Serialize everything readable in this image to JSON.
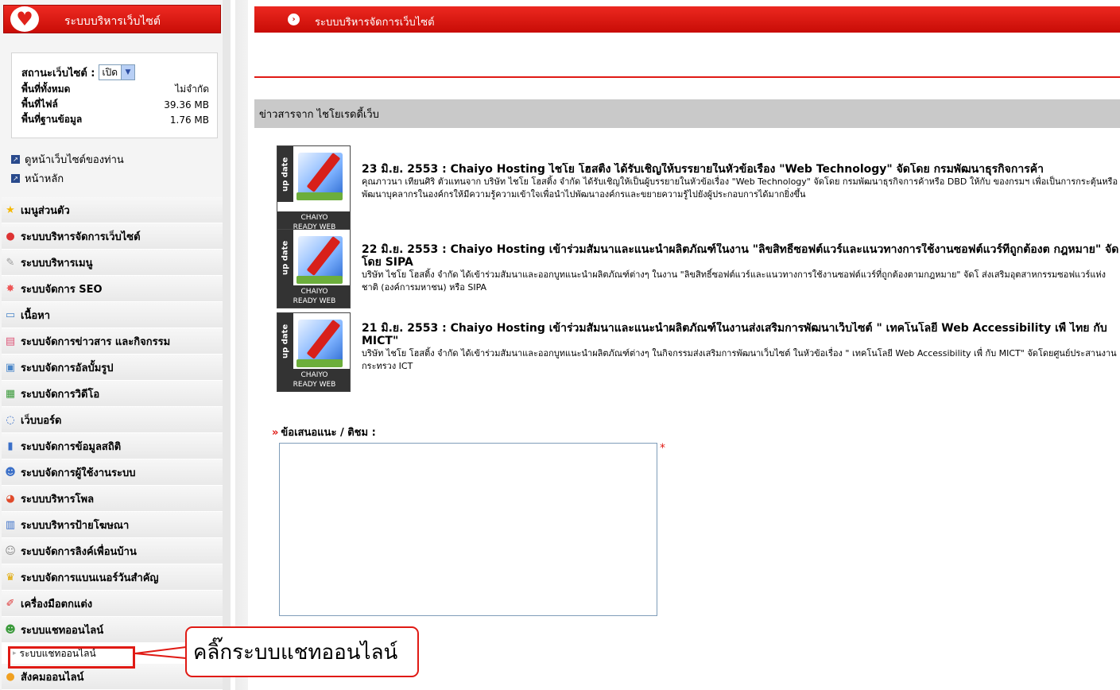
{
  "sidebar": {
    "header_title": "ระบบบริหารเว็บไซต์",
    "status": {
      "label": "สถานะเว็บไซต์ :",
      "select_value": "เปิด",
      "rows": [
        {
          "label": "พื้นที่ทั้งหมด",
          "value": "ไม่จำกัด"
        },
        {
          "label": "พื้นที่ไฟล์",
          "value": "39.36 MB"
        },
        {
          "label": "พื้นที่ฐานข้อมูล",
          "value": "1.76 MB"
        }
      ]
    },
    "links": {
      "view_site": "ดูหน้าเว็บไซต์ของท่าน",
      "home": "หน้าหลัก"
    },
    "menu": [
      {
        "label": "เมนูส่วนตัว",
        "icon": "star-icon"
      },
      {
        "label": "ระบบบริหารจัดการเว็บไซต์",
        "icon": "globe-icon"
      },
      {
        "label": "ระบบบริหารเมนู",
        "icon": "menu-icon"
      },
      {
        "label": "ระบบจัดการ SEO",
        "icon": "seo-icon"
      },
      {
        "label": "เนื้อหา",
        "icon": "document-icon"
      },
      {
        "label": "ระบบจัดการข่าวสาร และกิจกรรม",
        "icon": "news-icon"
      },
      {
        "label": "ระบบจัดการอัลบั้มรูป",
        "icon": "album-icon"
      },
      {
        "label": "ระบบจัดการวิดีโอ",
        "icon": "video-icon"
      },
      {
        "label": "เว็บบอร์ด",
        "icon": "chat-bubble-icon"
      },
      {
        "label": "ระบบจัดการข้อมูลสถิติ",
        "icon": "bar-chart-icon"
      },
      {
        "label": "ระบบจัดการผู้ใช้งานระบบ",
        "icon": "user-icon"
      },
      {
        "label": "ระบบบริหารโพล",
        "icon": "pie-chart-icon"
      },
      {
        "label": "ระบบบริหารป้ายโฆษณา",
        "icon": "banner-icon"
      },
      {
        "label": "ระบบจัดการลิงค์เพื่อนบ้าน",
        "icon": "link-user-icon"
      },
      {
        "label": "ระบบจัดการแบนเนอร์วันสำคัญ",
        "icon": "crown-icon"
      },
      {
        "label": "เครื่องมือตกแต่ง",
        "icon": "paint-tools-icon"
      },
      {
        "label": "ระบบแชทออนไลน์",
        "icon": "chat-users-icon"
      }
    ],
    "submenu_chat": "ระบบแชทออนไลน์",
    "menu_last": {
      "label": "สังคมออนไลน์",
      "icon": "social-icon"
    }
  },
  "main": {
    "header_title": "ระบบบริหารจัดการเว็บไซต์",
    "news_section_title": "ข่าวสารจาก ไชโยเรดดี้เว็บ",
    "thumb": {
      "tab": "up date",
      "footer_line1": "CHAIYO",
      "footer_line2": "READY WEB"
    },
    "news": [
      {
        "title": "23 มิ.ย. 2553 : Chaiyo Hosting ไชโย โฮสติ้ง ได้รับเชิญให้บรรยายในหัวข้อเรื่อง \"Web Technology\" จัดโดย กรมพัฒนาธุรกิจการค้า",
        "desc": "คุณภาวนา เทียนศิริ ตัวแทนจาก บริษัท ไชโย โฮสติ้ง จำกัด ได้รับเชิญให้เป็นผู้บรรยายในหัวข้อเรื่อง \"Web Technology\" จัดโดย กรมพัฒนาธุรกิจการค้าหรือ DBD ให้กับ ของกรมฯ เพื่อเป็นการกระตุ้นหรือพัฒนาบุคลากรในองค์กรให้มีความรู้ความเข้าใจเพื่อนำไปพัฒนาองค์กรและขยายความรู้ไปยังผู้ประกอบการได้มากยิ่งขึ้น"
      },
      {
        "title": "22 มิ.ย. 2553 : Chaiyo Hosting เข้าร่วมสัมนาและแนะนำผลิตภัณฑ์ในงาน \"ลิขสิทธิ์ซอฟต์แวร์และแนวทางการใช้งานซอฟต์แวร์ที่ถูกต้องต กฎหมาย\" จัดโดย SIPA",
        "desc": "บริษัท ไชโย โฮสติ้ง จำกัด ได้เข้าร่วมสัมนาและออกบูทแนะนำผลิตภัณฑ์ต่างๆ ในงาน \"ลิขสิทธิ์ซอฟต์แวร์และแนวทางการใช้งานซอฟต์แวร์ที่ถูกต้องตามกฎหมาย\" จัดโ ส่งเสริมอุตสาหกรรมซอฟแวร์แห่งชาติ (องค์การมหาชน) หรือ SIPA"
      },
      {
        "title": "21 มิ.ย. 2553 : Chaiyo Hosting เข้าร่วมสัมนาและแนะนำผลิตภัณฑ์ในงานส่งเสริมการพัฒนาเว็บไซต์ \" เทคโนโลยี Web Accessibility เพื่ ไทย กับ MICT\"",
        "desc": "บริษัท ไชโย โฮสติ้ง จำกัด ได้เข้าร่วมสัมนาและออกบูทแนะนำผลิตภัณฑ์ต่างๆ ในกิจกรรมส่งเสริมการพัฒนาเว็บไซต์ ในหัวข้อเรื่อง \" เทคโนโลยี Web Accessibility เพื่ กับ MICT\" จัดโดยศูนย์ประสานงานกระทรวง ICT"
      }
    ],
    "feedback_label": "ข้อเสนอแนะ / ติชม :",
    "feedback_value": "",
    "required_mark": "*"
  },
  "annotation": {
    "callout_text": "คลิ๊กระบบแชทออนไลน์"
  },
  "colors": {
    "brand_red": "#e01a14",
    "sidebar_bg": "#f4f4f4",
    "news_bar": "#c9c9c9"
  }
}
